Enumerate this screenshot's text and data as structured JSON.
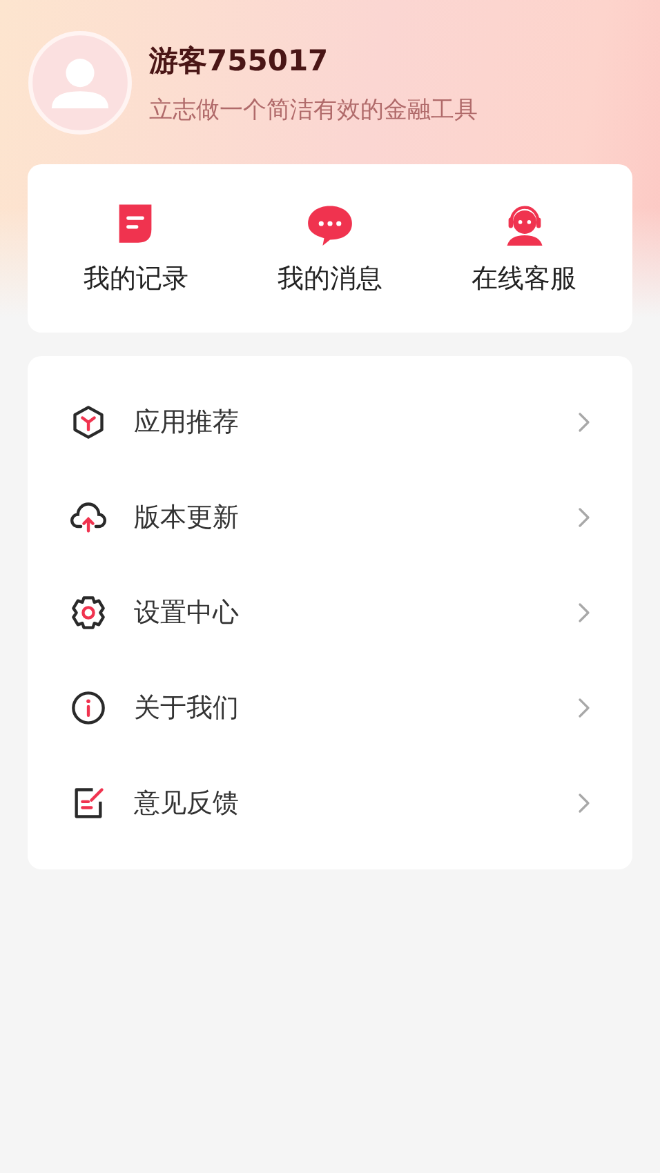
{
  "profile": {
    "name": "游客755017",
    "tagline": "立志做一个简洁有效的金融工具"
  },
  "shortcuts": [
    {
      "kind": "record",
      "label": "我的记录"
    },
    {
      "kind": "message",
      "label": "我的消息"
    },
    {
      "kind": "service",
      "label": "在线客服"
    }
  ],
  "menu": [
    {
      "kind": "apps",
      "label": "应用推荐"
    },
    {
      "kind": "update",
      "label": "版本更新"
    },
    {
      "kind": "settings",
      "label": "设置中心"
    },
    {
      "kind": "about",
      "label": "关于我们"
    },
    {
      "kind": "feedback",
      "label": "意见反馈"
    }
  ]
}
